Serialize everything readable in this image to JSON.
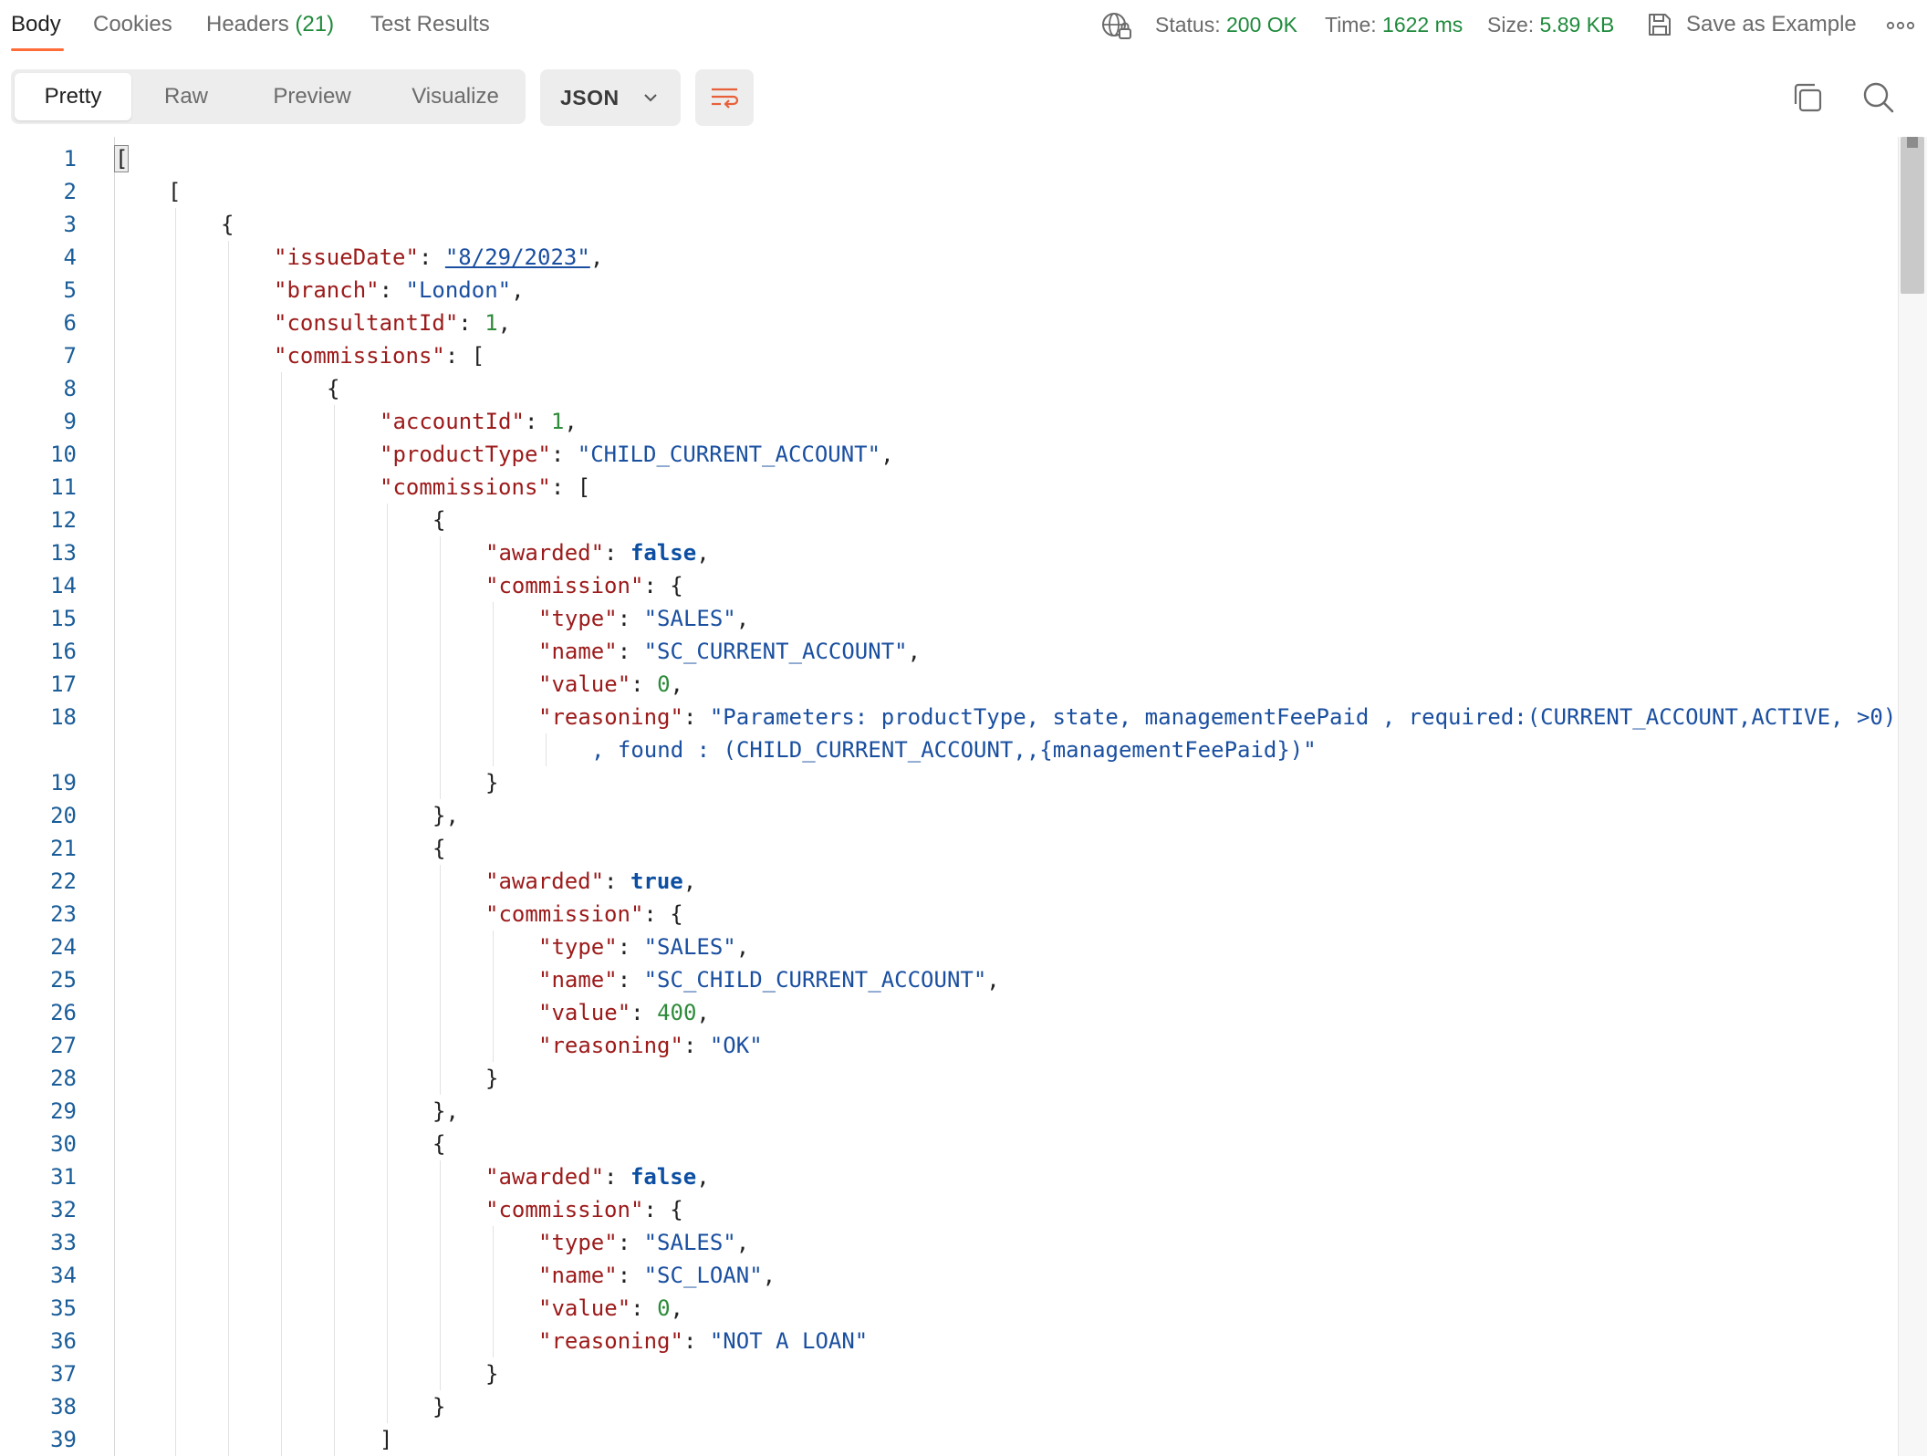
{
  "response_tabs": [
    {
      "label": "Body",
      "count": ""
    },
    {
      "label": "Cookies",
      "count": ""
    },
    {
      "label": "Headers",
      "count": "(21)"
    },
    {
      "label": "Test Results",
      "count": ""
    }
  ],
  "status": {
    "label": "Status:",
    "value": "200 OK"
  },
  "time": {
    "label": "Time:",
    "value": "1622 ms"
  },
  "size": {
    "label": "Size:",
    "value": "5.89 KB"
  },
  "save_example_label": "Save as Example",
  "view_modes": [
    "Pretty",
    "Raw",
    "Preview",
    "Visualize"
  ],
  "active_view_mode": "Pretty",
  "format": "JSON",
  "colors": {
    "accent": "#ff6c37",
    "status_ok": "#1e8a3b",
    "key": "#9c1a1a",
    "string": "#1a4fa0",
    "number": "#2e8b3a"
  },
  "icons": [
    "globe-lock-icon",
    "save-icon",
    "more-icon",
    "chevron-down-icon",
    "wrap-lines-icon",
    "copy-icon",
    "search-icon"
  ],
  "lines": [
    {
      "num": "1",
      "tokens": [
        {
          "t": "[",
          "c": "p"
        }
      ]
    },
    {
      "num": "2",
      "tokens": [
        {
          "t": "[",
          "c": "p"
        }
      ]
    },
    {
      "num": "3",
      "tokens": [
        {
          "t": "{",
          "c": "p"
        }
      ]
    },
    {
      "num": "4",
      "tokens": [
        {
          "t": "\"issueDate\"",
          "c": "k"
        },
        {
          "t": ": ",
          "c": "p"
        },
        {
          "t": "\"8/29/2023\"",
          "c": "su"
        },
        {
          "t": ",",
          "c": "p"
        }
      ]
    },
    {
      "num": "5",
      "tokens": [
        {
          "t": "\"branch\"",
          "c": "k"
        },
        {
          "t": ": ",
          "c": "p"
        },
        {
          "t": "\"London\"",
          "c": "s"
        },
        {
          "t": ",",
          "c": "p"
        }
      ]
    },
    {
      "num": "6",
      "tokens": [
        {
          "t": "\"consultantId\"",
          "c": "k"
        },
        {
          "t": ": ",
          "c": "p"
        },
        {
          "t": "1",
          "c": "n"
        },
        {
          "t": ",",
          "c": "p"
        }
      ]
    },
    {
      "num": "7",
      "tokens": [
        {
          "t": "\"commissions\"",
          "c": "k"
        },
        {
          "t": ": [",
          "c": "p"
        }
      ]
    },
    {
      "num": "8",
      "tokens": [
        {
          "t": "{",
          "c": "p"
        }
      ]
    },
    {
      "num": "9",
      "tokens": [
        {
          "t": "\"accountId\"",
          "c": "k"
        },
        {
          "t": ": ",
          "c": "p"
        },
        {
          "t": "1",
          "c": "n"
        },
        {
          "t": ",",
          "c": "p"
        }
      ]
    },
    {
      "num": "10",
      "tokens": [
        {
          "t": "\"productType\"",
          "c": "k"
        },
        {
          "t": ": ",
          "c": "p"
        },
        {
          "t": "\"CHILD_CURRENT_ACCOUNT\"",
          "c": "s"
        },
        {
          "t": ",",
          "c": "p"
        }
      ]
    },
    {
      "num": "11",
      "tokens": [
        {
          "t": "\"commissions\"",
          "c": "k"
        },
        {
          "t": ": [",
          "c": "p"
        }
      ]
    },
    {
      "num": "12",
      "tokens": [
        {
          "t": "{",
          "c": "p"
        }
      ]
    },
    {
      "num": "13",
      "tokens": [
        {
          "t": "\"awarded\"",
          "c": "k"
        },
        {
          "t": ": ",
          "c": "p"
        },
        {
          "t": "false",
          "c": "b"
        },
        {
          "t": ",",
          "c": "p"
        }
      ]
    },
    {
      "num": "14",
      "tokens": [
        {
          "t": "\"commission\"",
          "c": "k"
        },
        {
          "t": ": {",
          "c": "p"
        }
      ]
    },
    {
      "num": "15",
      "tokens": [
        {
          "t": "\"type\"",
          "c": "k"
        },
        {
          "t": ": ",
          "c": "p"
        },
        {
          "t": "\"SALES\"",
          "c": "s"
        },
        {
          "t": ",",
          "c": "p"
        }
      ]
    },
    {
      "num": "16",
      "tokens": [
        {
          "t": "\"name\"",
          "c": "k"
        },
        {
          "t": ": ",
          "c": "p"
        },
        {
          "t": "\"SC_CURRENT_ACCOUNT\"",
          "c": "s"
        },
        {
          "t": ",",
          "c": "p"
        }
      ]
    },
    {
      "num": "17",
      "tokens": [
        {
          "t": "\"value\"",
          "c": "k"
        },
        {
          "t": ": ",
          "c": "p"
        },
        {
          "t": "0",
          "c": "n"
        },
        {
          "t": ",",
          "c": "p"
        }
      ]
    },
    {
      "num": "18",
      "tokens": [
        {
          "t": "\"reasoning\"",
          "c": "k"
        },
        {
          "t": ": ",
          "c": "p"
        },
        {
          "t": "\"Parameters: productType, state, managementFeePaid , required:(CURRENT_ACCOUNT,ACTIVE, >0)",
          "c": "s"
        }
      ]
    },
    {
      "num": "",
      "tokens": [
        {
          "t": ", found : (CHILD_CURRENT_ACCOUNT,,{managementFeePaid})\"",
          "c": "s"
        }
      ]
    },
    {
      "num": "19",
      "tokens": [
        {
          "t": "}",
          "c": "p"
        }
      ]
    },
    {
      "num": "20",
      "tokens": [
        {
          "t": "},",
          "c": "p"
        }
      ]
    },
    {
      "num": "21",
      "tokens": [
        {
          "t": "{",
          "c": "p"
        }
      ]
    },
    {
      "num": "22",
      "tokens": [
        {
          "t": "\"awarded\"",
          "c": "k"
        },
        {
          "t": ": ",
          "c": "p"
        },
        {
          "t": "true",
          "c": "b"
        },
        {
          "t": ",",
          "c": "p"
        }
      ]
    },
    {
      "num": "23",
      "tokens": [
        {
          "t": "\"commission\"",
          "c": "k"
        },
        {
          "t": ": {",
          "c": "p"
        }
      ]
    },
    {
      "num": "24",
      "tokens": [
        {
          "t": "\"type\"",
          "c": "k"
        },
        {
          "t": ": ",
          "c": "p"
        },
        {
          "t": "\"SALES\"",
          "c": "s"
        },
        {
          "t": ",",
          "c": "p"
        }
      ]
    },
    {
      "num": "25",
      "tokens": [
        {
          "t": "\"name\"",
          "c": "k"
        },
        {
          "t": ": ",
          "c": "p"
        },
        {
          "t": "\"SC_CHILD_CURRENT_ACCOUNT\"",
          "c": "s"
        },
        {
          "t": ",",
          "c": "p"
        }
      ]
    },
    {
      "num": "26",
      "tokens": [
        {
          "t": "\"value\"",
          "c": "k"
        },
        {
          "t": ": ",
          "c": "p"
        },
        {
          "t": "400",
          "c": "n"
        },
        {
          "t": ",",
          "c": "p"
        }
      ]
    },
    {
      "num": "27",
      "tokens": [
        {
          "t": "\"reasoning\"",
          "c": "k"
        },
        {
          "t": ": ",
          "c": "p"
        },
        {
          "t": "\"OK\"",
          "c": "s"
        }
      ]
    },
    {
      "num": "28",
      "tokens": [
        {
          "t": "}",
          "c": "p"
        }
      ]
    },
    {
      "num": "29",
      "tokens": [
        {
          "t": "},",
          "c": "p"
        }
      ]
    },
    {
      "num": "30",
      "tokens": [
        {
          "t": "{",
          "c": "p"
        }
      ]
    },
    {
      "num": "31",
      "tokens": [
        {
          "t": "\"awarded\"",
          "c": "k"
        },
        {
          "t": ": ",
          "c": "p"
        },
        {
          "t": "false",
          "c": "b"
        },
        {
          "t": ",",
          "c": "p"
        }
      ]
    },
    {
      "num": "32",
      "tokens": [
        {
          "t": "\"commission\"",
          "c": "k"
        },
        {
          "t": ": {",
          "c": "p"
        }
      ]
    },
    {
      "num": "33",
      "tokens": [
        {
          "t": "\"type\"",
          "c": "k"
        },
        {
          "t": ": ",
          "c": "p"
        },
        {
          "t": "\"SALES\"",
          "c": "s"
        },
        {
          "t": ",",
          "c": "p"
        }
      ]
    },
    {
      "num": "34",
      "tokens": [
        {
          "t": "\"name\"",
          "c": "k"
        },
        {
          "t": ": ",
          "c": "p"
        },
        {
          "t": "\"SC_LOAN\"",
          "c": "s"
        },
        {
          "t": ",",
          "c": "p"
        }
      ]
    },
    {
      "num": "35",
      "tokens": [
        {
          "t": "\"value\"",
          "c": "k"
        },
        {
          "t": ": ",
          "c": "p"
        },
        {
          "t": "0",
          "c": "n"
        },
        {
          "t": ",",
          "c": "p"
        }
      ]
    },
    {
      "num": "36",
      "tokens": [
        {
          "t": "\"reasoning\"",
          "c": "k"
        },
        {
          "t": ": ",
          "c": "p"
        },
        {
          "t": "\"NOT A LOAN\"",
          "c": "s"
        }
      ]
    },
    {
      "num": "37",
      "tokens": [
        {
          "t": "}",
          "c": "p"
        }
      ]
    },
    {
      "num": "38",
      "tokens": [
        {
          "t": "}",
          "c": "p"
        }
      ]
    },
    {
      "num": "39",
      "tokens": [
        {
          "t": "]",
          "c": "p"
        }
      ]
    }
  ]
}
